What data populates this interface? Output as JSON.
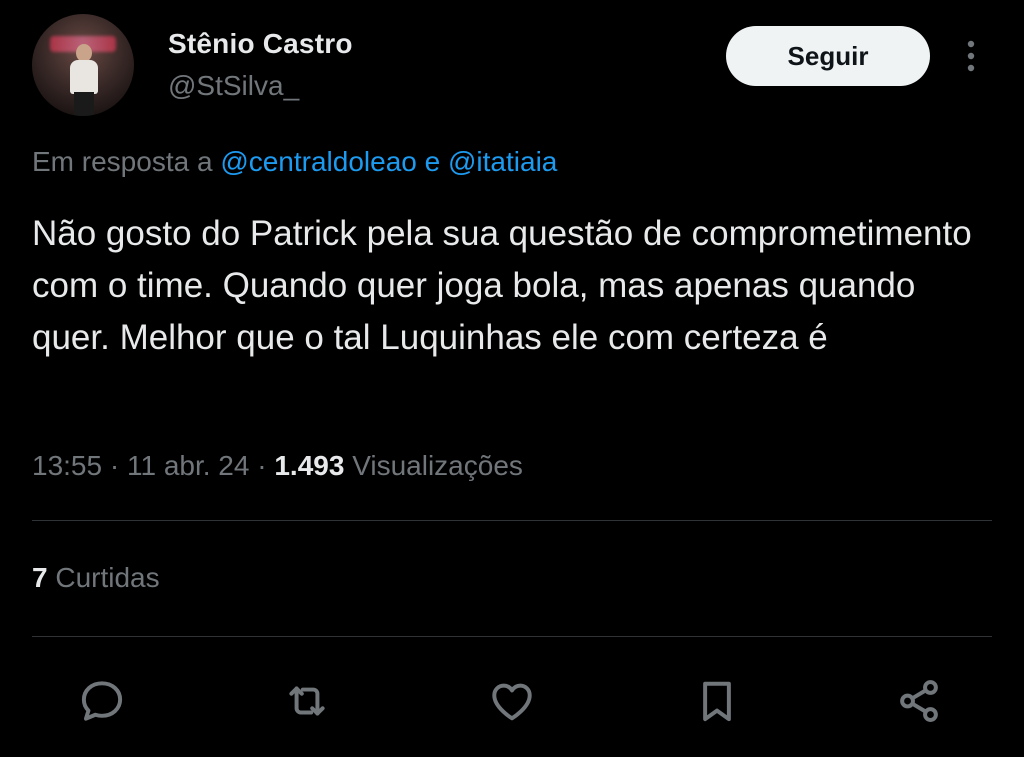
{
  "author": {
    "name": "Stênio Castro",
    "handle": "@StSilva_"
  },
  "follow_button": {
    "label": "Seguir"
  },
  "reply_context": {
    "prefix": "Em resposta a",
    "mention_1": "@centraldoleao",
    "joiner": "e",
    "mention_2": "@itatiaia"
  },
  "tweet": {
    "text": "Não gosto do Patrick pela sua questão de comprometimento com o time. Quando quer joga bola, mas apenas quando quer. Melhor que o tal Luquinhas ele com certeza é"
  },
  "meta": {
    "time": "13:55",
    "date": "11 abr. 24",
    "separator": "·",
    "views_count": "1.493",
    "views_label": "Visualizações"
  },
  "likes": {
    "count": "7",
    "label": "Curtidas"
  },
  "actions": [
    {
      "icon": "reply-icon"
    },
    {
      "icon": "retweet-icon"
    },
    {
      "icon": "heart-icon"
    },
    {
      "icon": "bookmark-icon"
    },
    {
      "icon": "share-icon"
    }
  ],
  "colors": {
    "background": "#000000",
    "primary_text": "#e7e9ea",
    "secondary_text": "#71767b",
    "link": "#1d9bf0",
    "divider": "#2f3336",
    "button_bg": "#eff3f4"
  }
}
